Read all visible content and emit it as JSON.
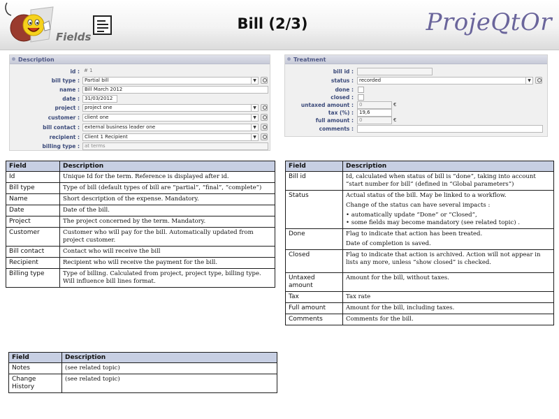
{
  "header": {
    "logo_text": "Fields",
    "title": "Bill (2/3)",
    "brand": "ProjeQtOr"
  },
  "description_panel": {
    "title": "Description",
    "fields": {
      "id": {
        "label": "id :",
        "value": "# 1"
      },
      "bill_type": {
        "label": "bill type :",
        "value": "Partial bill"
      },
      "name": {
        "label": "name :",
        "value": "Bill March 2012"
      },
      "date": {
        "label": "date :",
        "value": "31/03/2012"
      },
      "project": {
        "label": "project :",
        "value": "project one"
      },
      "customer": {
        "label": "customer :",
        "value": "client one"
      },
      "bill_contact": {
        "label": "bill contact :",
        "value": "external business leader one"
      },
      "recipient": {
        "label": "recipient :",
        "value": "Client 1 Recipient"
      },
      "billing_type": {
        "label": "billing type :",
        "value": "at terms"
      }
    }
  },
  "treatment_panel": {
    "title": "Treatment",
    "fields": {
      "bill_id": {
        "label": "bill id :",
        "value": ""
      },
      "status": {
        "label": "status :",
        "value": "recorded"
      },
      "done": {
        "label": "done :"
      },
      "closed": {
        "label": "closed :"
      },
      "untaxed_amount": {
        "label": "untaxed amount :",
        "value": "0",
        "currency": "€"
      },
      "tax": {
        "label": "tax (%) :",
        "value": "19,6"
      },
      "full_amount": {
        "label": "full amount :",
        "value": "0",
        "currency": "€"
      },
      "comments": {
        "label": "comments :",
        "value": ""
      }
    }
  },
  "table_left": {
    "headers": [
      "Field",
      "Description"
    ],
    "rows": [
      {
        "field": "Id",
        "description": "Unique Id for the term. Reference is displayed after id."
      },
      {
        "field": "Bill type",
        "description": "Type of bill (default types of bill are “partial”, “final”, “complete”)"
      },
      {
        "field": "Name",
        "description": "Short description of the expense. Mandatory."
      },
      {
        "field": "Date",
        "description": "Date of the bill."
      },
      {
        "field": "Project",
        "description": "The project concerned by the term. Mandatory."
      },
      {
        "field": "Customer",
        "description": "Customer who will pay for the bill. Automatically updated from project customer."
      },
      {
        "field": "Bill contact",
        "description": "Contact who will receive the bill"
      },
      {
        "field": "Recipient",
        "description": "Recipient who will receive the payment for the bill."
      },
      {
        "field": "Billing type",
        "description": "Type of billing. Calculated from project, project type, billing type. Will influence bill lines format."
      }
    ]
  },
  "table_right": {
    "headers": [
      "Field",
      "Description"
    ],
    "rows": [
      {
        "field": "Bill id",
        "lines": [
          "Id, calculated when status of bill is “done”, taking into account “start number for bill” (defined in “Global parameters”)"
        ]
      },
      {
        "field": "Status",
        "lines": [
          "Actual status of the bill. May be linked to a workflow.",
          "Change of the status can have several impacts :",
          "• automatically update “Done” or “Closed”,",
          "• some fields may become mandatory (see related topic) ."
        ]
      },
      {
        "field": "Done",
        "lines": [
          "Flag to indicate that action has been treated.",
          "Date of completion is saved."
        ]
      },
      {
        "field": "Closed",
        "lines": [
          "Flag to indicate that action is archived. Action will not appear in lists any more, unless “show closed” is checked."
        ]
      },
      {
        "field": "Untaxed amount",
        "lines": [
          "Amount for the bill, without taxes."
        ]
      },
      {
        "field": "Tax",
        "lines": [
          "Tax rate"
        ]
      },
      {
        "field": "Full amount",
        "lines": [
          "Amount for the bill, including taxes."
        ]
      },
      {
        "field": "Comments",
        "lines": [
          "Comments for the bill."
        ]
      }
    ]
  },
  "table_bottom": {
    "headers": [
      "Field",
      "Description"
    ],
    "rows": [
      {
        "field": "Notes",
        "description": "(see related topic)"
      },
      {
        "field": "Change History",
        "description": "(see related topic)"
      }
    ]
  }
}
